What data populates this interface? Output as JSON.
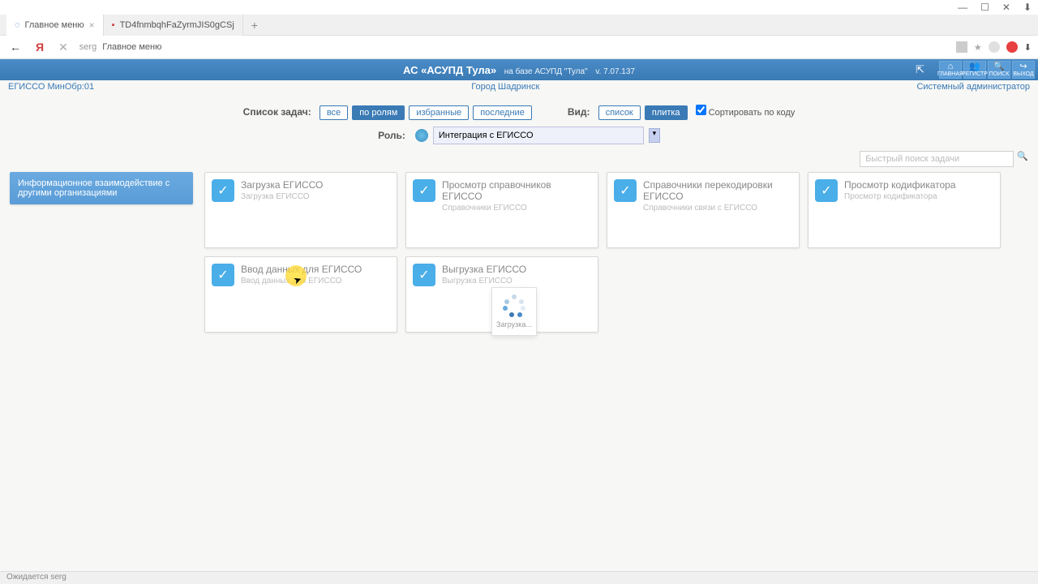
{
  "window": {
    "min": "—",
    "max": "☐",
    "close": "✕",
    "download": "⬇"
  },
  "tabs": [
    {
      "title": "Главное меню",
      "active": true
    },
    {
      "title": "TD4fnmbqhFaZyrmJIS0gCSj",
      "active": false,
      "pdf": true
    }
  ],
  "addressbar": {
    "back": "←",
    "yandex": "Я",
    "stop": "✕",
    "prefix": "serg",
    "text": "Главное меню"
  },
  "header": {
    "title_main": "АС «АСУПД Тула»",
    "title_sub": "на базе АСУПД \"Тула\"",
    "version": "v. 7.07.137",
    "buttons": [
      {
        "name": "home",
        "label": "ГЛАВНАЯ",
        "icon": "⌂"
      },
      {
        "name": "registry",
        "label": "РЕГИСТР",
        "icon": "👥"
      },
      {
        "name": "search",
        "label": "ПОИСК",
        "icon": "🔍"
      },
      {
        "name": "exit",
        "label": "ВЫХОД",
        "icon": "↪"
      }
    ]
  },
  "subheader": {
    "left": "ЕГИССО МинОбр:01",
    "center": "Город Шадринск",
    "right": "Системный администратор"
  },
  "filters": {
    "list_label": "Список задач:",
    "pills": [
      "все",
      "по ролям",
      "избранные",
      "последние"
    ],
    "active_pill": 1,
    "view_label": "Вид:",
    "view_pills": [
      "список",
      "плитка"
    ],
    "active_view": 1,
    "sort_label": "Сортировать по коду",
    "role_label": "Роль:",
    "role_value": "Интеграция с ЕГИССО"
  },
  "search": {
    "placeholder": "Быстрый поиск задачи"
  },
  "sidebar": {
    "item": "Информационное взаимодействие с другими организациями"
  },
  "tiles": [
    {
      "title": "Загрузка ЕГИССО",
      "sub": "Загрузка ЕГИССО"
    },
    {
      "title": "Просмотр справочников ЕГИССО",
      "sub": "Справочники ЕГИССО"
    },
    {
      "title": "Справочники перекодировки ЕГИССО",
      "sub": "Справочники связи с ЕГИССО"
    },
    {
      "title": "Просмотр кодификатора",
      "sub": "Просмотр кодификатора"
    },
    {
      "title": "Ввод данных для ЕГИССО",
      "sub": "Ввод данных для ЕГИССО"
    },
    {
      "title": "Выгрузка ЕГИССО",
      "sub": "Выгрузка ЕГИССО"
    }
  ],
  "loading": {
    "text": "Загрузка..."
  },
  "status": {
    "text": "Ожидается serg"
  }
}
